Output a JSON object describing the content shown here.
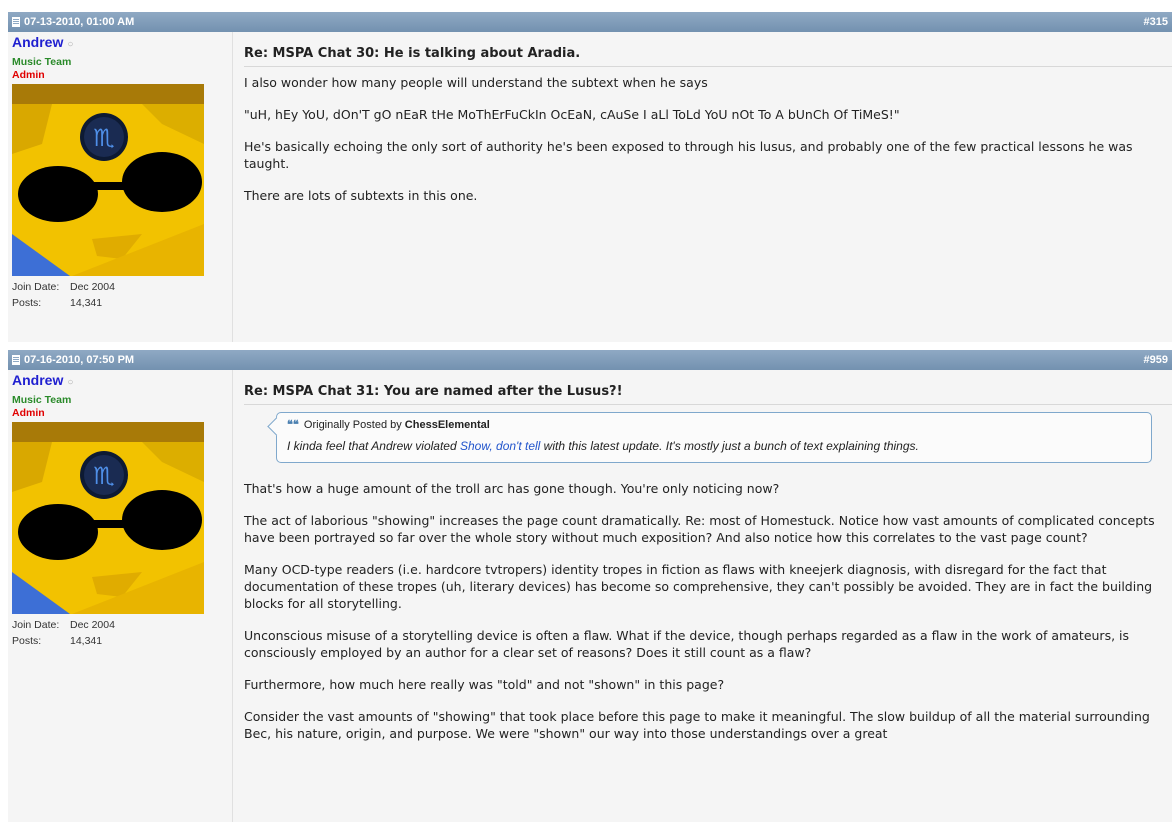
{
  "posts": [
    {
      "date": "07-13-2010, 01:00 AM",
      "number": "#315",
      "user": {
        "name": "Andrew",
        "status": "○",
        "title": "Music Team",
        "rank": "Admin",
        "join_label": "Join Date:",
        "join_value": "Dec 2004",
        "posts_label": "Posts:",
        "posts_value": "14,341"
      },
      "title": "Re: MSPA Chat 30: He is talking about Aradia.",
      "paragraphs": [
        "I also wonder how many people will understand the subtext when he says",
        "\"uH, hEy YoU, dOn'T gO nEaR tHe MoThErFuCkIn OcEaN, cAuSe I aLl ToLd YoU nOt To A bUnCh Of TiMeS!\"",
        "He's basically echoing the only sort of authority he's been exposed to through his lusus, and probably one of the few practical lessons he was taught.",
        "There are lots of subtexts in this one."
      ]
    },
    {
      "date": "07-16-2010, 07:50 PM",
      "number": "#959",
      "user": {
        "name": "Andrew",
        "status": "○",
        "title": "Music Team",
        "rank": "Admin",
        "join_label": "Join Date:",
        "join_value": "Dec 2004",
        "posts_label": "Posts:",
        "posts_value": "14,341"
      },
      "title": "Re: MSPA Chat 31: You are named after the Lusus?!",
      "quote": {
        "icon": "❝❝",
        "prefix": "Originally Posted by",
        "author": "ChessElemental",
        "text_before": "I kinda feel that Andrew violated ",
        "link": "Show, don't tell",
        "text_after": " with this latest update. It's mostly just a bunch of text explaining things."
      },
      "paragraphs": [
        "That's how a huge amount of the troll arc has gone though. You're only noticing now?",
        "The act of laborious \"showing\" increases the page count dramatically. Re: most of Homestuck. Notice how vast amounts of complicated concepts have been portrayed so far over the whole story without much exposition? And also notice how this correlates to the vast page count?",
        "Many OCD-type readers (i.e. hardcore tvtropers) identity tropes in fiction as flaws with kneejerk diagnosis, with disregard for the fact that documentation of these tropes (uh, literary devices) has become so comprehensive, they can't possibly be avoided. They are in fact the building blocks for all storytelling.",
        "Unconscious misuse of a storytelling device is often a flaw. What if the device, though perhaps regarded as a flaw in the work of amateurs, is consciously employed by an author for a clear set of reasons? Does it still count as a flaw?",
        "Furthermore, how much here really was \"told\" and not \"shown\" in this page?",
        "Consider the vast amounts of \"showing\" that took place before this page to make it meaningful. The slow buildup of all the material surrounding Bec, his nature, origin, and purpose. We were \"shown\" our way into those understandings over a great"
      ]
    }
  ],
  "colors": {
    "header_bg": "#7e9bb8",
    "username": "#1f1fd0",
    "usertitle": "#2a8a2a",
    "rank": "#e00000",
    "quote_border": "#7fa8cc",
    "link": "#2255cc"
  }
}
